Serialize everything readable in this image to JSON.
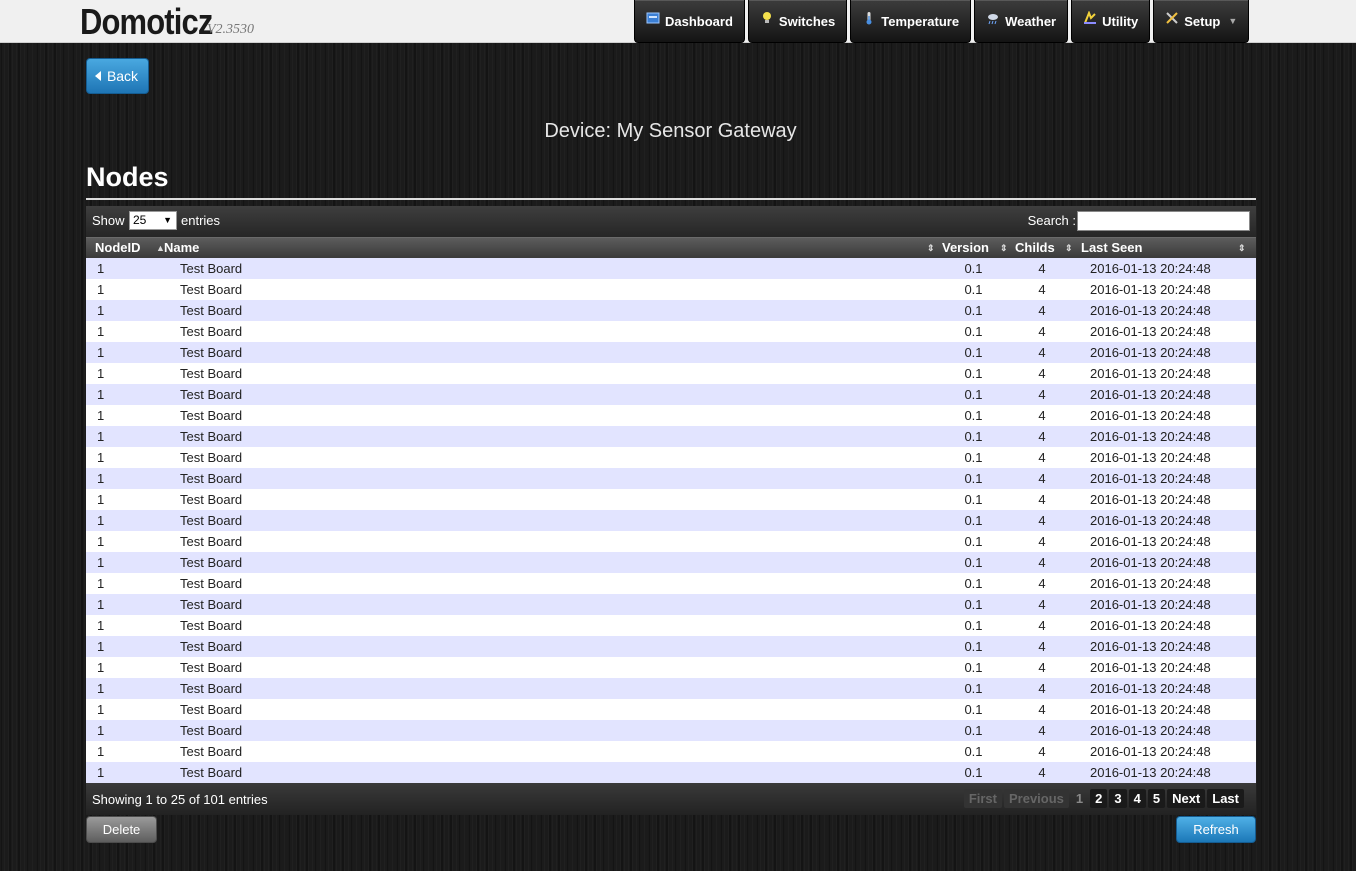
{
  "header": {
    "brand": "Domoticz",
    "version": "V2.3530",
    "nav": [
      {
        "label": "Dashboard",
        "icon": "dashboard-icon"
      },
      {
        "label": "Switches",
        "icon": "lightbulb-icon"
      },
      {
        "label": "Temperature",
        "icon": "thermometer-icon"
      },
      {
        "label": "Weather",
        "icon": "weather-cloud-icon"
      },
      {
        "label": "Utility",
        "icon": "utility-meter-icon"
      },
      {
        "label": "Setup",
        "icon": "tools-icon"
      }
    ]
  },
  "back_label": "Back",
  "device_title": "Device: My Sensor Gateway",
  "section_title": "Nodes",
  "table": {
    "show_label": "Show",
    "length_value": "25",
    "entries_label": "entries",
    "search_label": "Search :",
    "search_value": "",
    "columns": [
      "NodeID",
      "Name",
      "Version",
      "Childs",
      "Last Seen"
    ],
    "rows": [
      [
        "1",
        "Test Board",
        "0.1",
        "4",
        "2016-01-13 20:24:48"
      ],
      [
        "1",
        "Test Board",
        "0.1",
        "4",
        "2016-01-13 20:24:48"
      ],
      [
        "1",
        "Test Board",
        "0.1",
        "4",
        "2016-01-13 20:24:48"
      ],
      [
        "1",
        "Test Board",
        "0.1",
        "4",
        "2016-01-13 20:24:48"
      ],
      [
        "1",
        "Test Board",
        "0.1",
        "4",
        "2016-01-13 20:24:48"
      ],
      [
        "1",
        "Test Board",
        "0.1",
        "4",
        "2016-01-13 20:24:48"
      ],
      [
        "1",
        "Test Board",
        "0.1",
        "4",
        "2016-01-13 20:24:48"
      ],
      [
        "1",
        "Test Board",
        "0.1",
        "4",
        "2016-01-13 20:24:48"
      ],
      [
        "1",
        "Test Board",
        "0.1",
        "4",
        "2016-01-13 20:24:48"
      ],
      [
        "1",
        "Test Board",
        "0.1",
        "4",
        "2016-01-13 20:24:48"
      ],
      [
        "1",
        "Test Board",
        "0.1",
        "4",
        "2016-01-13 20:24:48"
      ],
      [
        "1",
        "Test Board",
        "0.1",
        "4",
        "2016-01-13 20:24:48"
      ],
      [
        "1",
        "Test Board",
        "0.1",
        "4",
        "2016-01-13 20:24:48"
      ],
      [
        "1",
        "Test Board",
        "0.1",
        "4",
        "2016-01-13 20:24:48"
      ],
      [
        "1",
        "Test Board",
        "0.1",
        "4",
        "2016-01-13 20:24:48"
      ],
      [
        "1",
        "Test Board",
        "0.1",
        "4",
        "2016-01-13 20:24:48"
      ],
      [
        "1",
        "Test Board",
        "0.1",
        "4",
        "2016-01-13 20:24:48"
      ],
      [
        "1",
        "Test Board",
        "0.1",
        "4",
        "2016-01-13 20:24:48"
      ],
      [
        "1",
        "Test Board",
        "0.1",
        "4",
        "2016-01-13 20:24:48"
      ],
      [
        "1",
        "Test Board",
        "0.1",
        "4",
        "2016-01-13 20:24:48"
      ],
      [
        "1",
        "Test Board",
        "0.1",
        "4",
        "2016-01-13 20:24:48"
      ],
      [
        "1",
        "Test Board",
        "0.1",
        "4",
        "2016-01-13 20:24:48"
      ],
      [
        "1",
        "Test Board",
        "0.1",
        "4",
        "2016-01-13 20:24:48"
      ],
      [
        "1",
        "Test Board",
        "0.1",
        "4",
        "2016-01-13 20:24:48"
      ],
      [
        "1",
        "Test Board",
        "0.1",
        "4",
        "2016-01-13 20:24:48"
      ]
    ],
    "info": "Showing 1 to 25 of 101 entries",
    "pager": {
      "first": "First",
      "previous": "Previous",
      "pages": [
        "1",
        "2",
        "3",
        "4",
        "5"
      ],
      "current_page": "1",
      "next": "Next",
      "last": "Last"
    }
  },
  "delete_label": "Delete",
  "refresh_label": "Refresh",
  "colors": {
    "row_odd": "#e2e4ff",
    "row_even": "#ffffff",
    "accent_blue": "#1e75b5"
  }
}
